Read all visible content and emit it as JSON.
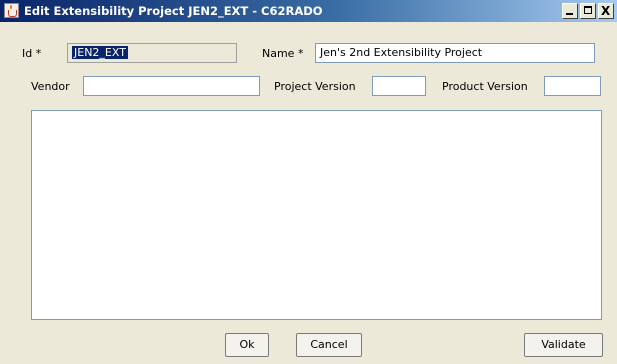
{
  "window": {
    "title": "Edit Extensibility Project JEN2_EXT - C62RADO",
    "controls": {
      "minimize": "_",
      "maximize": "□",
      "close": "X"
    }
  },
  "form": {
    "id_label": "Id *",
    "id_value": "JEN2_EXT",
    "name_label": "Name *",
    "name_value": "Jen's 2nd Extensibility Project",
    "vendor_label": "Vendor",
    "vendor_value": "",
    "project_version_label": "Project Version",
    "project_version_value": "",
    "product_version_label": "Product Version",
    "product_version_value": "",
    "description_value": ""
  },
  "buttons": {
    "ok": "Ok",
    "cancel": "Cancel",
    "validate": "Validate"
  }
}
